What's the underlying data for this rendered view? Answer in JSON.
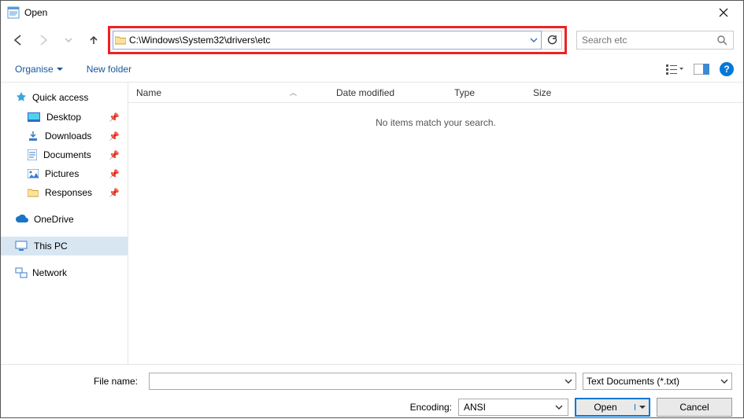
{
  "window": {
    "title": "Open"
  },
  "address": {
    "path": "C:\\Windows\\System32\\drivers\\etc"
  },
  "search": {
    "placeholder": "Search etc"
  },
  "toolbar": {
    "organise": "Organise",
    "newfolder": "New folder"
  },
  "columns": {
    "name": "Name",
    "date": "Date modified",
    "type": "Type",
    "size": "Size"
  },
  "content": {
    "empty": "No items match your search."
  },
  "sidebar": {
    "quick": "Quick access",
    "items": [
      {
        "label": "Desktop"
      },
      {
        "label": "Downloads"
      },
      {
        "label": "Documents"
      },
      {
        "label": "Pictures"
      },
      {
        "label": "Responses"
      }
    ],
    "onedrive": "OneDrive",
    "thispc": "This PC",
    "network": "Network"
  },
  "footer": {
    "filename_label": "File name:",
    "filename_value": "",
    "filetype": "Text Documents (*.txt)",
    "encoding_label": "Encoding:",
    "encoding_value": "ANSI",
    "open": "Open",
    "cancel": "Cancel"
  }
}
